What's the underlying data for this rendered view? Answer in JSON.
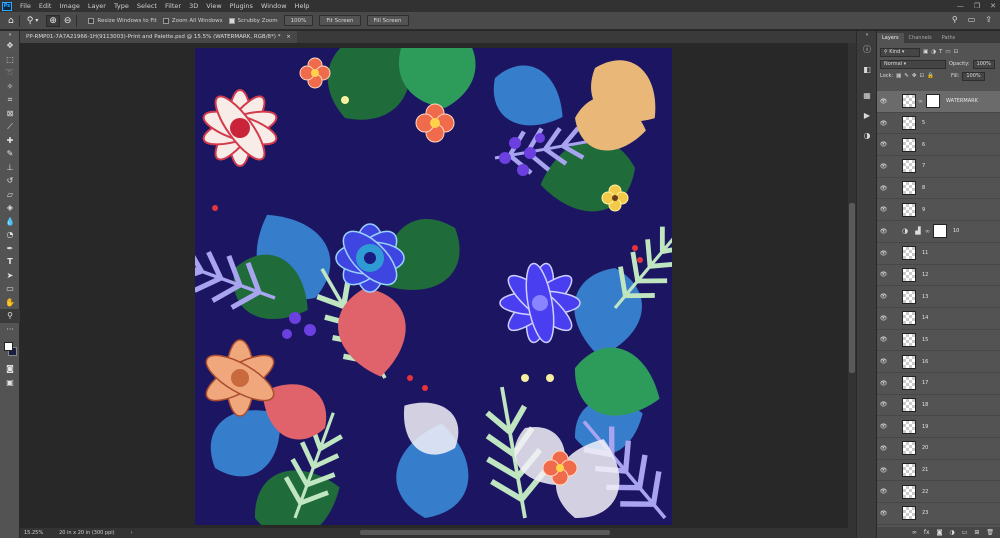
{
  "app": {
    "logo": "Ps"
  },
  "menu": [
    "File",
    "Edit",
    "Image",
    "Layer",
    "Type",
    "Select",
    "Filter",
    "3D",
    "View",
    "Plugins",
    "Window",
    "Help"
  ],
  "window_controls": {
    "minimize": "—",
    "restore": "❐",
    "close": "✕"
  },
  "options": {
    "tool_icon": "zoom-tool-icon",
    "resize_windows_label": "Resize Windows to Fit",
    "zoom_all_label": "Zoom All Windows",
    "scrubby_zoom_label": "Scrubby Zoom",
    "zoom_100_label": "100%",
    "fit_screen_label": "Fit Screen",
    "fill_screen_label": "Fill Screen"
  },
  "document": {
    "tab_title": "PP-RMP01-7A7A21966-1H(9113003)-Print and Palette.psd @ 15.5% (WATERMARK, RGB/8*) *",
    "tab_close": "×"
  },
  "status": {
    "zoom": "15.25%",
    "doc_size": "20 in x 20 in (300 ppi)",
    "arrow": "›"
  },
  "panel": {
    "tabs": [
      "Layers",
      "Channels",
      "Paths"
    ],
    "filter_kind": "Kind",
    "blend_mode": "Normal",
    "opacity_label": "Opacity:",
    "opacity_value": "100%",
    "lock_label": "Lock:",
    "fill_label": "Fill:",
    "fill_value": "100%",
    "layers": [
      {
        "name": "WATERMARK",
        "kind": "mask",
        "selected": true
      },
      {
        "name": "5",
        "kind": "normal"
      },
      {
        "name": "6",
        "kind": "normal"
      },
      {
        "name": "7",
        "kind": "normal"
      },
      {
        "name": "8",
        "kind": "normal"
      },
      {
        "name": "9",
        "kind": "normal"
      },
      {
        "name": "10",
        "kind": "adjustment"
      },
      {
        "name": "11",
        "kind": "normal"
      },
      {
        "name": "12",
        "kind": "normal"
      },
      {
        "name": "13",
        "kind": "normal"
      },
      {
        "name": "14",
        "kind": "normal"
      },
      {
        "name": "15",
        "kind": "normal"
      },
      {
        "name": "16",
        "kind": "normal"
      },
      {
        "name": "17",
        "kind": "normal"
      },
      {
        "name": "18",
        "kind": "normal"
      },
      {
        "name": "19",
        "kind": "normal"
      },
      {
        "name": "20",
        "kind": "normal"
      },
      {
        "name": "21",
        "kind": "normal"
      },
      {
        "name": "22",
        "kind": "normal"
      },
      {
        "name": "23",
        "kind": "normal"
      }
    ],
    "footer_icons": [
      "link-icon",
      "fx-icon",
      "mask-icon",
      "adjustment-icon",
      "folder-icon",
      "new-layer-icon",
      "trash-icon"
    ]
  },
  "colors": {
    "canvas_bg": "#1a1a5e",
    "foreground": "#ffffff",
    "background": "#1a1d40",
    "accent": "#31a8ff"
  }
}
